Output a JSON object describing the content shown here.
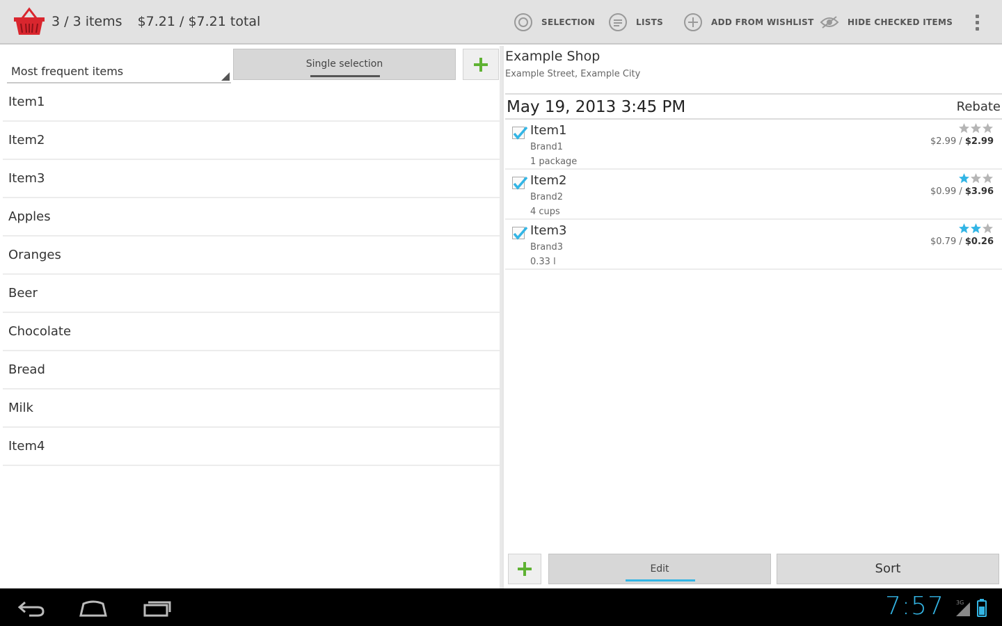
{
  "header": {
    "item_count": "3 / 3 items",
    "total": "$7.21 / $7.21 total",
    "actions": [
      {
        "label": "SELECTION",
        "icon": "selection-icon"
      },
      {
        "label": "LISTS",
        "icon": "lists-icon"
      },
      {
        "label": "ADD FROM WISHLIST",
        "icon": "wishlist-icon"
      },
      {
        "label": "HIDE CHECKED ITEMS",
        "icon": "hide-eye-icon"
      }
    ]
  },
  "left": {
    "spinner_label": "Most frequent items",
    "mode_button": "Single selection",
    "items": [
      "Item1",
      "Item2",
      "Item3",
      "Apples",
      "Oranges",
      "Beer",
      "Chocolate",
      "Bread",
      "Milk",
      "Item4"
    ]
  },
  "right": {
    "shop_name": "Example Shop",
    "shop_address": "Example Street, Example City",
    "date": "May 19, 2013 3:45 PM",
    "rebate_label": "Rebate",
    "entries": [
      {
        "name": "Item1",
        "brand": "Brand1",
        "quantity": "1 package",
        "unit_price": "$2.99",
        "total_price": "$2.99",
        "rating": 0,
        "checked": true
      },
      {
        "name": "Item2",
        "brand": "Brand2",
        "quantity": "4 cups",
        "unit_price": "$0.99",
        "total_price": "$3.96",
        "rating": 1,
        "checked": true
      },
      {
        "name": "Item3",
        "brand": "Brand3",
        "quantity": "0.33 l",
        "unit_price": "$0.79",
        "total_price": "$0.26",
        "rating": 2,
        "checked": true
      }
    ],
    "price_separator": " / ",
    "edit_button": "Edit",
    "sort_button": "Sort"
  },
  "system": {
    "clock": "7:57"
  },
  "colors": {
    "accent": "#33b5e5",
    "basket": "#d9262e",
    "add_green": "#5fb233",
    "star_off": "#b5b5b5"
  }
}
